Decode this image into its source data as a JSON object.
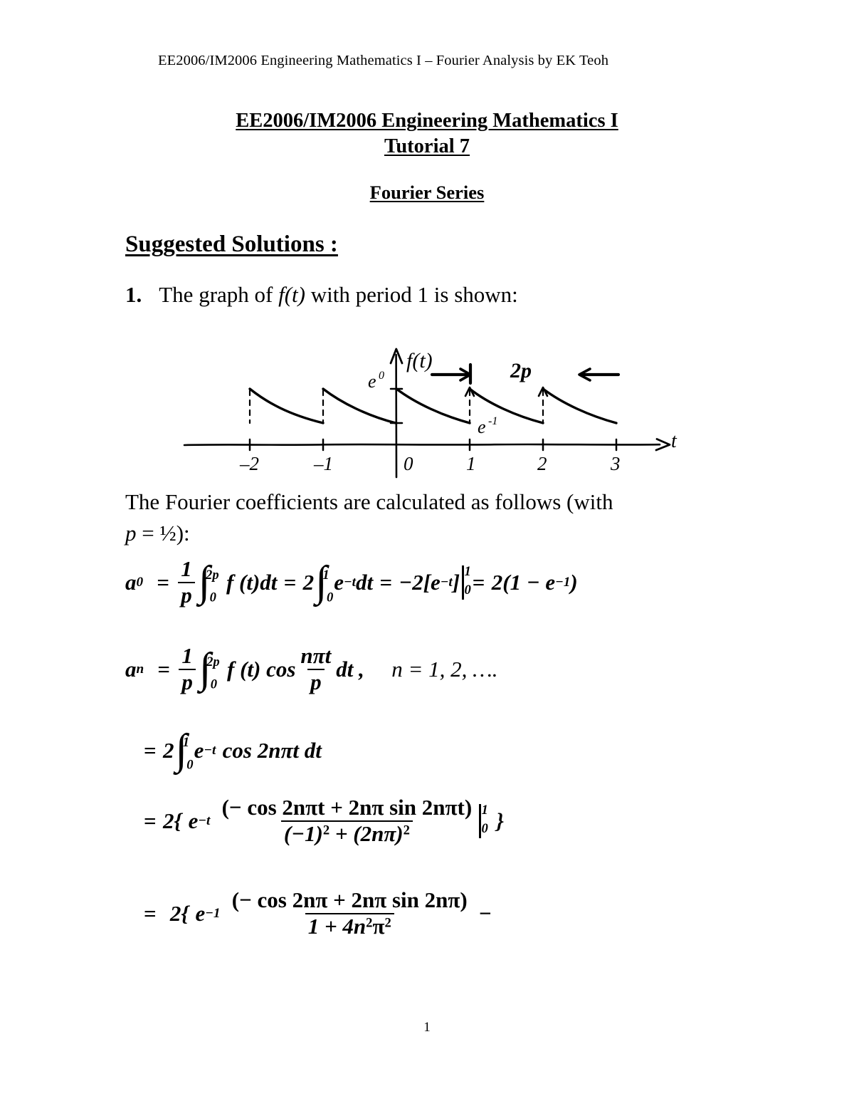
{
  "header": {
    "running_head": "EE2006/IM2006 Engineering Mathematics I – Fourier Analysis by EK Teoh"
  },
  "title": {
    "line1": "EE2006/IM2006 Engineering Mathematics I",
    "line2": "Tutorial 7",
    "subject": "Fourier Series"
  },
  "section": {
    "heading": "Suggested Solutions :"
  },
  "question": {
    "number": "1.",
    "text_a": "The graph of ",
    "text_f": "f",
    "text_paren_t": "(t)",
    "text_b": " with period 1 is shown:"
  },
  "figure": {
    "y_axis_label": "f(t)",
    "x_axis_label": "t",
    "peak_label": "e",
    "peak_exponent": "0",
    "trough_label": "e",
    "trough_exponent": "-1",
    "period_label": "2p",
    "x_ticks": [
      "-2",
      "-1",
      "0",
      "1",
      "2",
      "3"
    ],
    "description": "Hand-drawn sawtooth graph of exponential decay segments, period 1"
  },
  "paragraph": {
    "line1": "The Fourier coefficients are calculated as follows (with",
    "line2_p": "p",
    "line2_rest": " = ½):"
  },
  "equations": {
    "a0": {
      "lhs_sym": "a",
      "lhs_sub": "0",
      "eq1": "=",
      "frac_num": "1",
      "frac_den": "p",
      "int1_upper": "2p",
      "int1_lower": "0",
      "integrand1": "f (t)dt",
      "eq2": "=",
      "coef2": "2",
      "int2_upper": "1",
      "int2_lower": "0",
      "integrand2_e": "e",
      "integrand2_exp": "−t",
      "integrand2_dt": "dt",
      "eq3": "=",
      "result_a": "−2[e",
      "result_exp": "−t",
      "result_b": "]",
      "eval_upper": "1",
      "eval_lower": "0",
      "eq4": "=",
      "result_c": "2(1 − e",
      "result_c_exp": "−1",
      "result_d": ")"
    },
    "an": {
      "lhs_sym": "a",
      "lhs_sub": "n",
      "eq1": "=",
      "frac_num": "1",
      "frac_den": "p",
      "int_upper": "2p",
      "int_lower": "0",
      "integrand": "f (t) cos",
      "cos_frac_num": "nπt",
      "cos_frac_den": "p",
      "dt": "dt ,",
      "range": "n = 1, 2, …."
    },
    "line3": {
      "eq": "=",
      "coef": "2",
      "int_upper": "1",
      "int_lower": "0",
      "e": "e",
      "e_exp": "−t",
      "rest": "cos 2nπt dt"
    },
    "line4": {
      "eq": "=",
      "coef": "2{",
      "e": "e",
      "e_exp": "−t",
      "frac_num": "(− cos 2nπt + 2nπ sin 2nπt)",
      "frac_den_a": "(−1)",
      "frac_den_exp1": "2",
      "frac_den_b": " + (2nπ)",
      "frac_den_exp2": "2",
      "eval_upper": "1",
      "eval_lower": "0",
      "close": "}"
    },
    "line5": {
      "eq": "=",
      "coef": "2{",
      "e": "e",
      "e_exp": "−1",
      "frac_num": "(− cos 2nπ + 2nπ sin 2nπ)",
      "frac_den_a": "1 + 4n",
      "frac_den_exp1": "2",
      "frac_den_b": "π",
      "frac_den_exp2": "2",
      "trailing_minus": "−"
    }
  },
  "footer": {
    "page_number": "1"
  }
}
